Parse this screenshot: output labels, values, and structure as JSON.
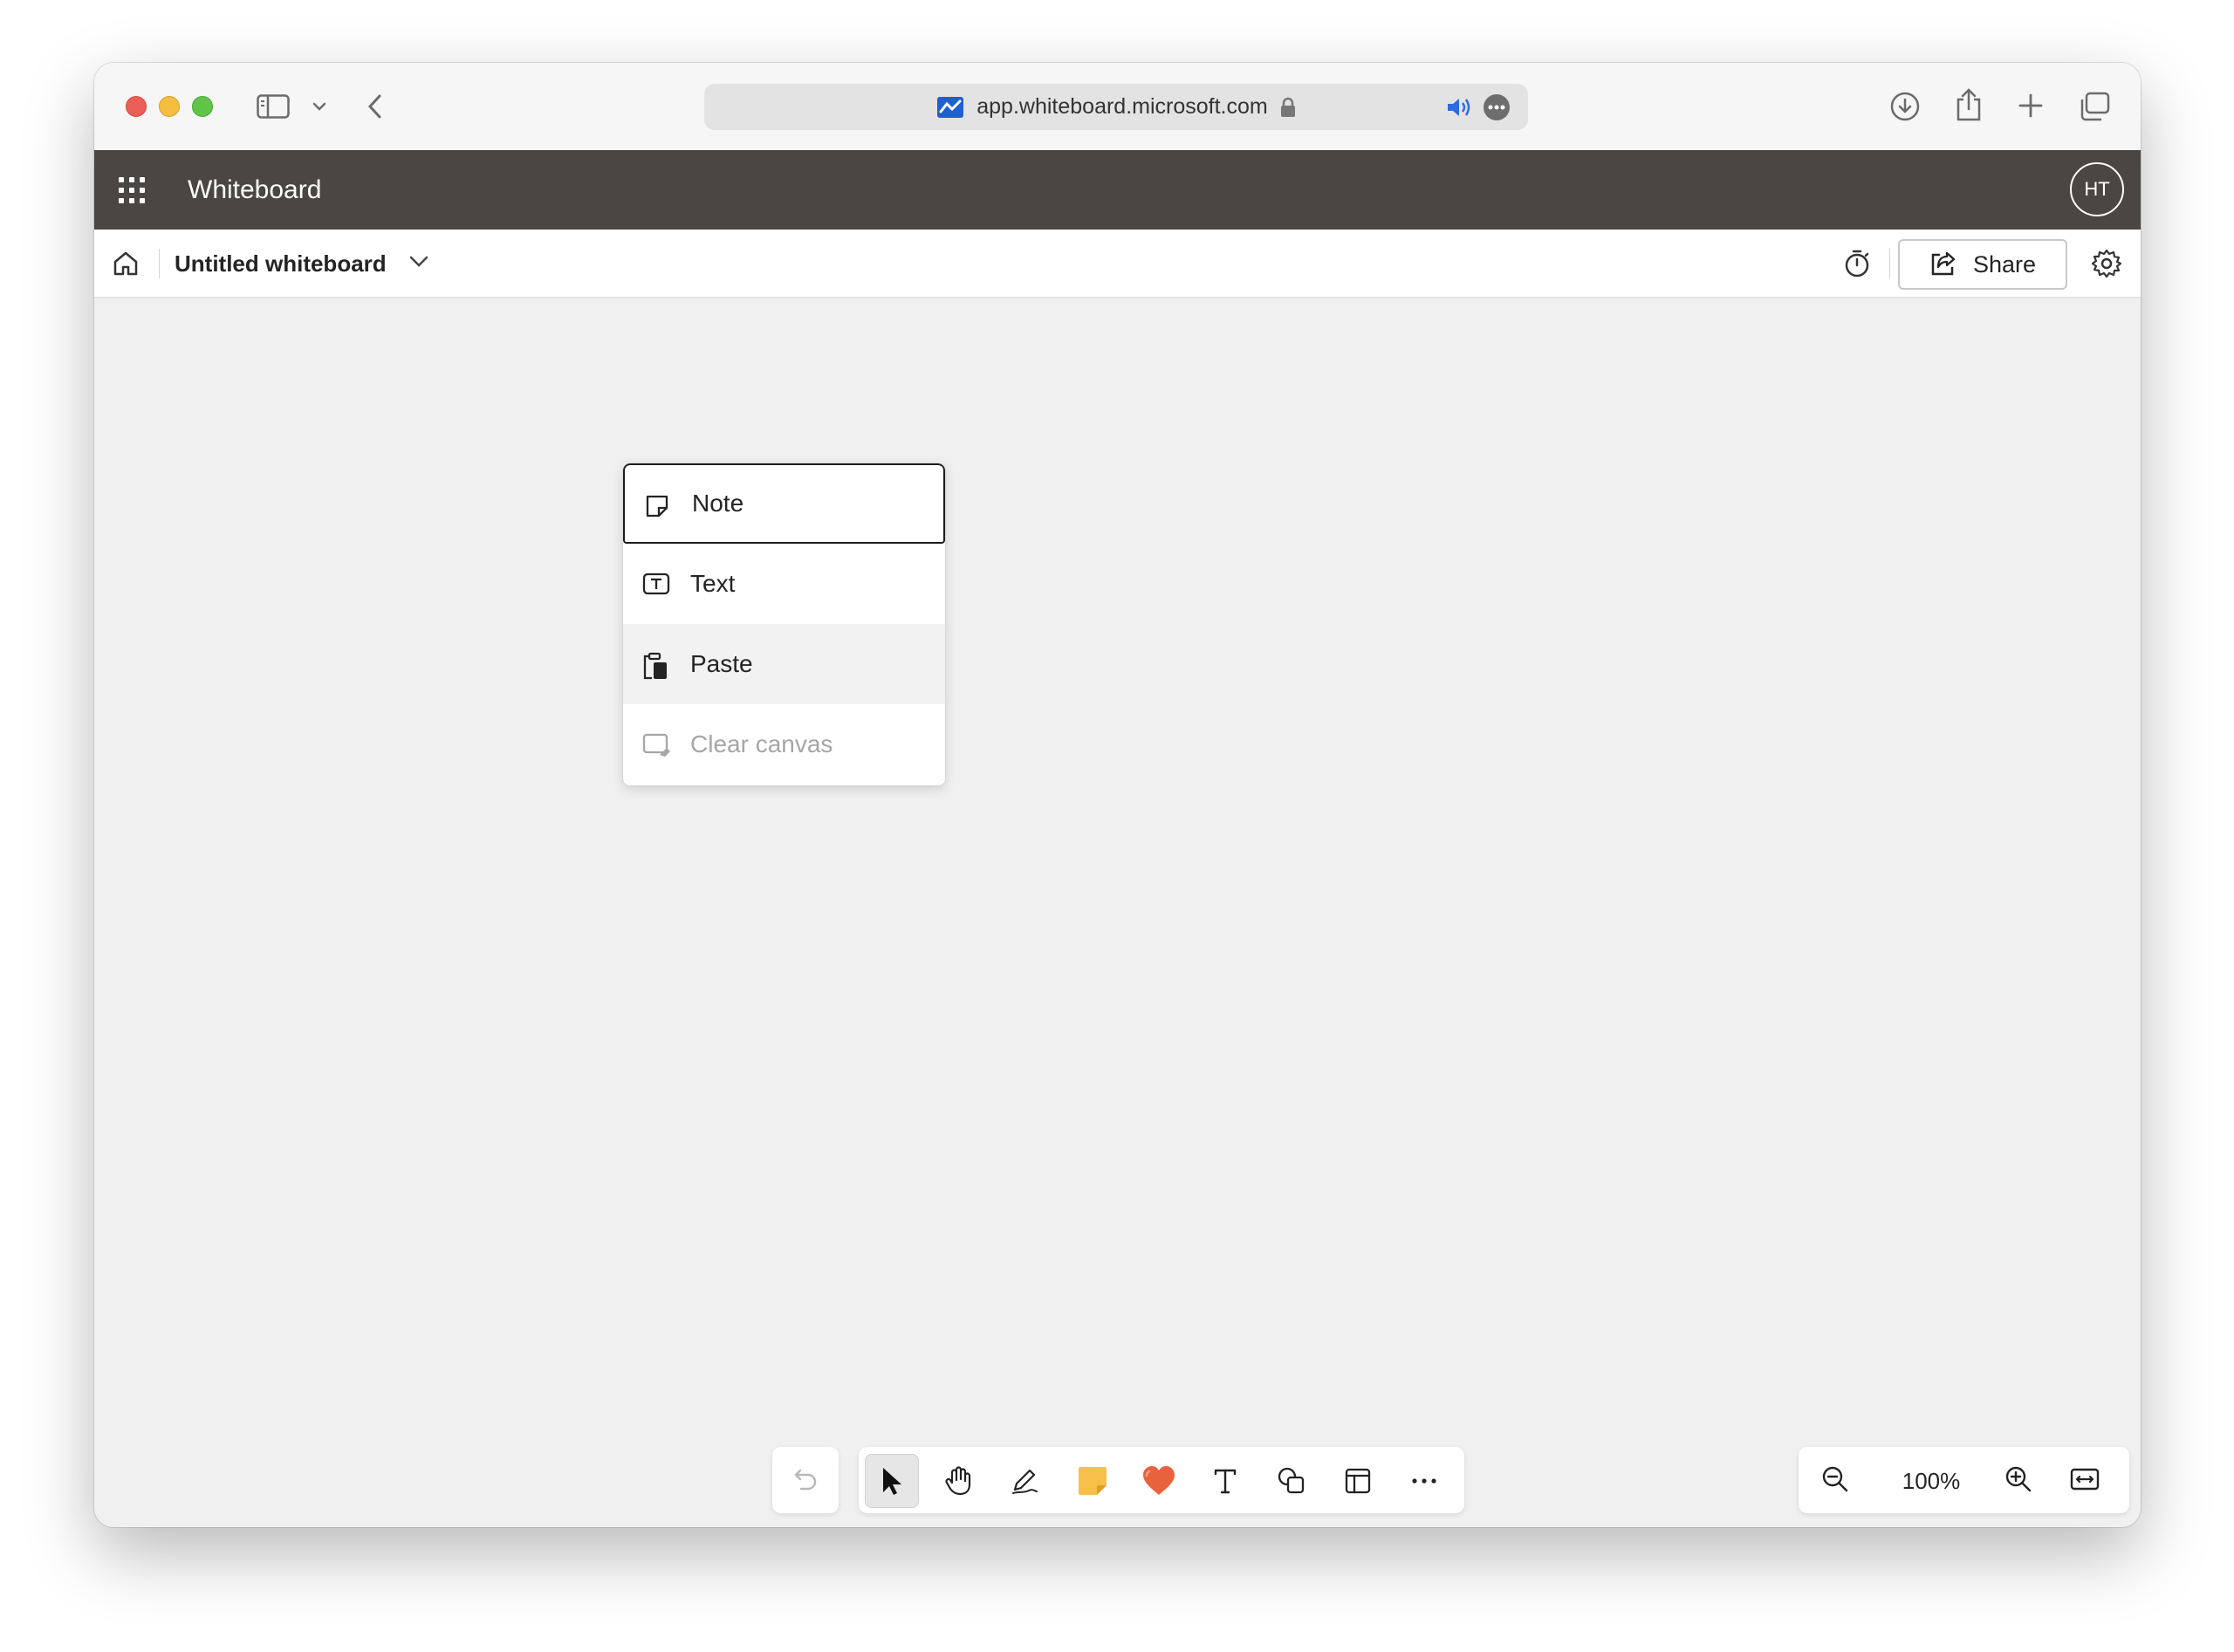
{
  "browser": {
    "url": "app.whiteboard.microsoft.com"
  },
  "app": {
    "title": "Whiteboard",
    "avatar_initials": "HT"
  },
  "commandbar": {
    "board_title": "Untitled whiteboard",
    "share_label": "Share"
  },
  "context_menu": {
    "items": [
      {
        "label": "Note",
        "icon": "sticky-note-icon",
        "state": "focused"
      },
      {
        "label": "Text",
        "icon": "text-box-icon",
        "state": "normal"
      },
      {
        "label": "Paste",
        "icon": "clipboard-icon",
        "state": "hovered"
      },
      {
        "label": "Clear canvas",
        "icon": "clear-canvas-icon",
        "state": "disabled"
      }
    ]
  },
  "toolbar": {
    "tools": [
      "undo-icon",
      "select-pointer-icon",
      "hand-pan-icon",
      "pen-icon",
      "sticky-note-icon",
      "reaction-heart-icon",
      "text-icon",
      "shapes-icon",
      "templates-icon",
      "more-icon"
    ],
    "active_tool": "select-pointer-icon"
  },
  "zoom": {
    "level": "100%"
  },
  "colors": {
    "app_header": "#494644",
    "canvas": "#f0f0f0",
    "sticky_note": "#f7c04a",
    "heart": "#e8623d"
  }
}
